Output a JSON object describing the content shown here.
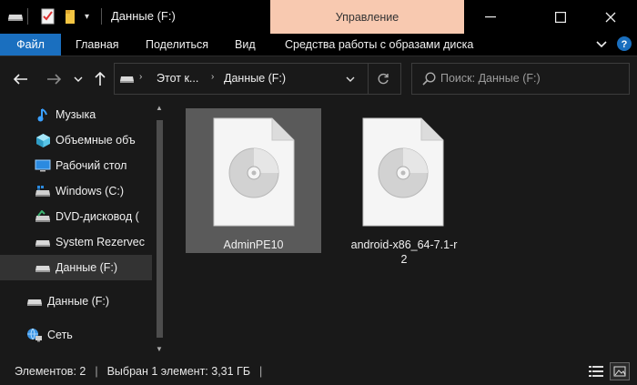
{
  "window": {
    "title": "Данные (F:)",
    "context_tab": "Управление"
  },
  "ribbon": {
    "tabs": [
      "Файл",
      "Главная",
      "Поделиться",
      "Вид",
      "Средства работы с образами диска"
    ]
  },
  "address": {
    "crumbs": [
      "Этот к...",
      "Данные (F:)"
    ]
  },
  "search": {
    "placeholder": "Поиск: Данные (F:)"
  },
  "sidebar": {
    "items": [
      {
        "label": "Музыка",
        "icon": "music-note-icon"
      },
      {
        "label": "Объемные объ",
        "icon": "3d-objects-icon"
      },
      {
        "label": "Рабочий стол",
        "icon": "desktop-icon"
      },
      {
        "label": "Windows (C:)",
        "icon": "windows-drive-icon"
      },
      {
        "label": "DVD-дисковод (",
        "icon": "dvd-drive-icon"
      },
      {
        "label": "System Rezervec",
        "icon": "drive-icon"
      },
      {
        "label": "Данные (F:)",
        "icon": "drive-icon",
        "selected": true
      },
      {
        "label": "Данные (F:)",
        "icon": "drive-icon"
      },
      {
        "label": "Сеть",
        "icon": "network-icon"
      }
    ]
  },
  "files": [
    {
      "name": "AdminPE10",
      "icon": "disc-image-file-icon",
      "selected": true
    },
    {
      "name_line1": "android-x86_64-7.1-r",
      "name_line2": "2",
      "icon": "disc-image-file-icon"
    }
  ],
  "status": {
    "count": "Элементов: 2",
    "selection": "Выбран 1 элемент: 3,31 ГБ"
  },
  "colors": {
    "file_tab": "#1a6fbf",
    "context_tab": "#f8c9b0",
    "selection": "#5a5a5a"
  }
}
